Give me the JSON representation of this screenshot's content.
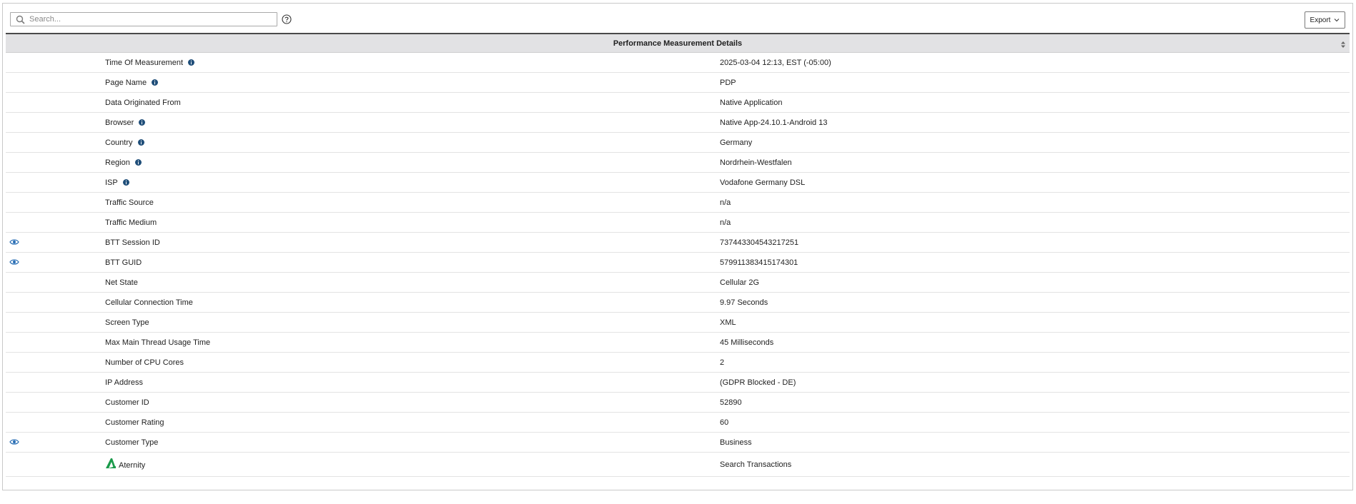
{
  "toolbar": {
    "search_placeholder": "Search...",
    "export_label": "Export"
  },
  "table": {
    "title": "Performance Measurement Details",
    "rows": [
      {
        "label": "Time Of Measurement",
        "value": "2025-03-04 12:13, EST (-05:00)",
        "info": true,
        "eye": false
      },
      {
        "label": "Page Name",
        "value": "PDP",
        "info": true,
        "eye": false
      },
      {
        "label": "Data Originated From",
        "value": "Native Application",
        "info": false,
        "eye": false
      },
      {
        "label": "Browser",
        "value": "Native App-24.10.1-Android 13",
        "info": true,
        "eye": false
      },
      {
        "label": "Country",
        "value": "Germany",
        "info": true,
        "eye": false
      },
      {
        "label": "Region",
        "value": "Nordrhein-Westfalen",
        "info": true,
        "eye": false
      },
      {
        "label": "ISP",
        "value": "Vodafone Germany DSL",
        "info": true,
        "eye": false
      },
      {
        "label": "Traffic Source",
        "value": "n/a",
        "info": false,
        "eye": false
      },
      {
        "label": "Traffic Medium",
        "value": "n/a",
        "info": false,
        "eye": false
      },
      {
        "label": "BTT Session ID",
        "value": "737443304543217251",
        "info": false,
        "eye": true
      },
      {
        "label": "BTT GUID",
        "value": "579911383415174301",
        "info": false,
        "eye": true
      },
      {
        "label": "Net State",
        "value": "Cellular 2G",
        "info": false,
        "eye": false
      },
      {
        "label": "Cellular Connection Time",
        "value": "9.97 Seconds",
        "info": false,
        "eye": false
      },
      {
        "label": "Screen Type",
        "value": "XML",
        "info": false,
        "eye": false
      },
      {
        "label": "Max Main Thread Usage Time",
        "value": "45 Milliseconds",
        "info": false,
        "eye": false
      },
      {
        "label": "Number of CPU Cores",
        "value": "2",
        "info": false,
        "eye": false
      },
      {
        "label": "IP Address",
        "value": "(GDPR Blocked - DE)",
        "info": false,
        "eye": false
      },
      {
        "label": "Customer ID",
        "value": "52890",
        "info": false,
        "eye": false
      },
      {
        "label": "Customer Rating",
        "value": "60",
        "info": false,
        "eye": false
      },
      {
        "label": "Customer Type",
        "value": "Business",
        "info": false,
        "eye": true
      }
    ],
    "aternity": {
      "label": "Aternity",
      "link": "Search Transactions"
    }
  },
  "colors": {
    "accent": "#2a6fb5",
    "header_bg": "#e2e2e4",
    "logo_green": "#1a9a4a"
  }
}
